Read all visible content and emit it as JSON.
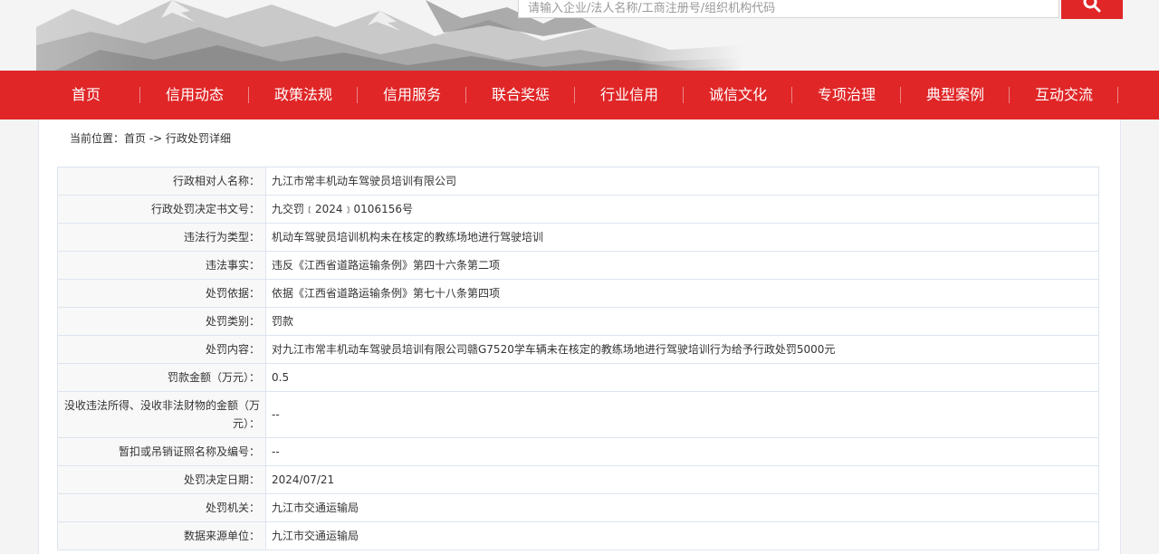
{
  "search": {
    "placeholder": "请输入企业/法人名称/工商注册号/组织机构代码"
  },
  "nav": {
    "items": [
      "首页",
      "信用动态",
      "政策法规",
      "信用服务",
      "联合奖惩",
      "行业信用",
      "诚信文化",
      "专项治理",
      "典型案例",
      "互动交流"
    ]
  },
  "breadcrumb": {
    "prefix": "当前位置：",
    "home": "首页",
    "separator": " -> ",
    "current": "行政处罚详细"
  },
  "details": [
    {
      "label": "行政相对人名称：",
      "value": "九江市常丰机动车驾驶员培训有限公司"
    },
    {
      "label": "行政处罚决定书文号：",
      "value": "九交罚﹝2024﹞0106156号"
    },
    {
      "label": "违法行为类型：",
      "value": "机动车驾驶员培训机构未在核定的教练场地进行驾驶培训"
    },
    {
      "label": "违法事实：",
      "value": "违反《江西省道路运输条例》第四十六条第二项"
    },
    {
      "label": "处罚依据：",
      "value": "依据《江西省道路运输条例》第七十八条第四项"
    },
    {
      "label": "处罚类别：",
      "value": "罚款"
    },
    {
      "label": "处罚内容：",
      "value": "对九江市常丰机动车驾驶员培训有限公司赣G7520学车辆未在核定的教练场地进行驾驶培训行为给予行政处罚5000元"
    },
    {
      "label": "罚款金额（万元）：",
      "value": "0.5"
    },
    {
      "label": "没收违法所得、没收非法财物的金额（万元）：",
      "value": "--"
    },
    {
      "label": "暂扣或吊销证照名称及编号：",
      "value": "--"
    },
    {
      "label": "处罚决定日期：",
      "value": "2024/07/21"
    },
    {
      "label": "处罚机关：",
      "value": "九江市交通运输局"
    },
    {
      "label": "数据来源单位：",
      "value": "九江市交通运输局"
    }
  ],
  "colors": {
    "brand_red": "#e02627",
    "page_bg": "#f4f4f4",
    "table_border": "#dde4ef",
    "label_bg": "#f8f8f8"
  },
  "icons": {
    "search": "search-icon"
  }
}
